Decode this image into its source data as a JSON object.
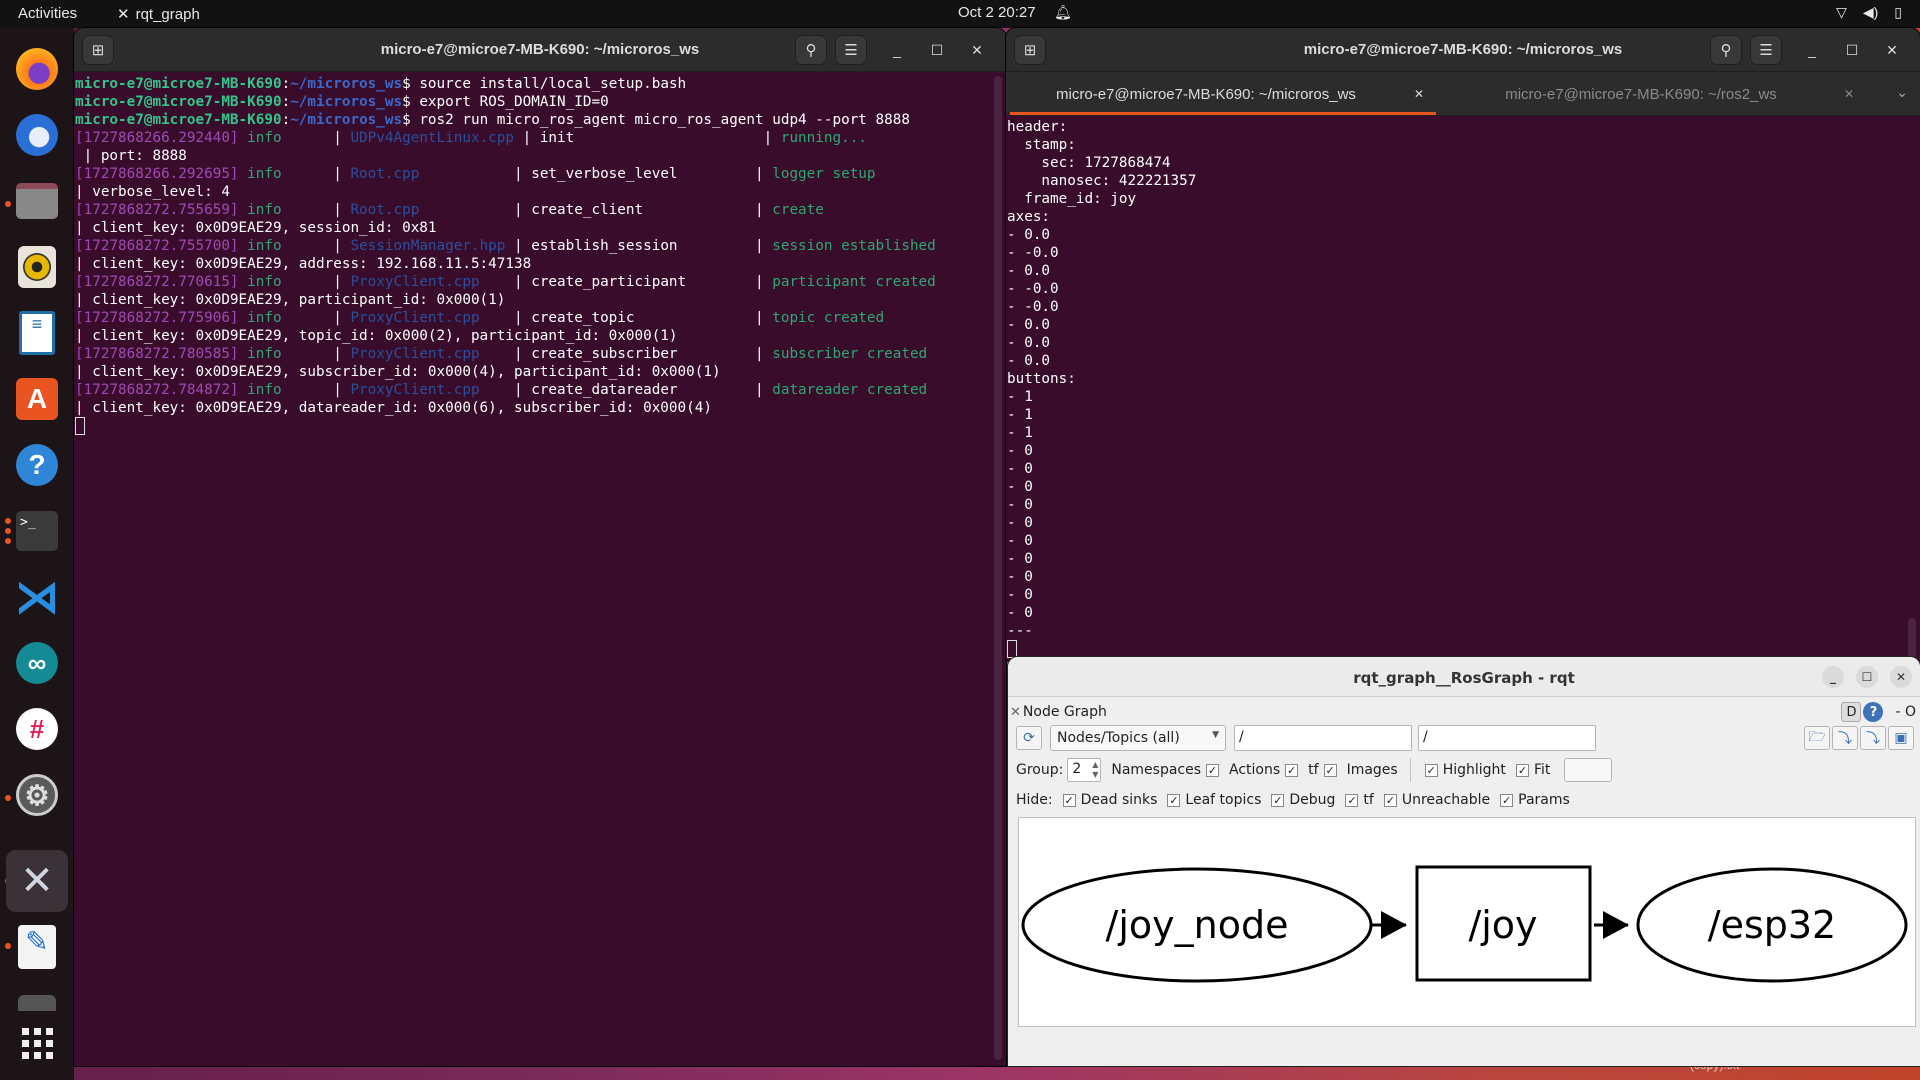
{
  "topbar": {
    "activities": "Activities",
    "app_name": "rqt_graph",
    "clock": "Oct 2  20:27",
    "tray_icons": [
      "network-icon",
      "volume-icon",
      "battery-icon"
    ]
  },
  "dock": {
    "items": [
      {
        "name": "firefox",
        "glyph": "🦊",
        "running": false
      },
      {
        "name": "thunderbird",
        "glyph": "✉",
        "running": false
      },
      {
        "name": "files",
        "glyph": "▬",
        "running": true
      },
      {
        "name": "rhythmbox",
        "glyph": "◉",
        "running": false
      },
      {
        "name": "libreoffice-writer",
        "glyph": "≡",
        "running": false
      },
      {
        "name": "app-center",
        "glyph": "A",
        "running": false
      },
      {
        "name": "help",
        "glyph": "?",
        "running": false
      },
      {
        "name": "terminal",
        "glyph": ">_",
        "running": true
      },
      {
        "name": "vscode",
        "glyph": "⋊",
        "running": false
      },
      {
        "name": "arduino",
        "glyph": "∞",
        "running": false
      },
      {
        "name": "slack",
        "glyph": "#",
        "running": false
      },
      {
        "name": "settings",
        "glyph": "⚙",
        "running": true
      },
      {
        "name": "rqt",
        "glyph": "✕",
        "running": true,
        "active": true
      },
      {
        "name": "text-editor",
        "glyph": "✎",
        "running": true
      },
      {
        "name": "trash",
        "glyph": "▭",
        "running": false
      },
      {
        "name": "show-apps",
        "glyph": "⠿",
        "running": false
      }
    ]
  },
  "left_terminal": {
    "title": "micro-e7@microe7-MB-K690: ~/microros_ws",
    "prompt_user": "micro-e7@microe7-MB-K690",
    "prompt_path": "~/microros_ws",
    "commands": [
      "source install/local_setup.bash",
      "export ROS_DOMAIN_ID=0",
      "ros2 run micro_ros_agent micro_ros_agent udp4 --port 8888"
    ],
    "log": [
      {
        "ts": "[1727868266.292440]",
        "level": "info",
        "file": "UDPv4AgentLinux.cpp",
        "func": "init",
        "msg": "running...",
        "detail": " | port: 8888"
      },
      {
        "ts": "[1727868266.292695]",
        "level": "info",
        "file": "Root.cpp",
        "func": "set_verbose_level",
        "msg": "logger setup",
        "detail": "| verbose_level: 4"
      },
      {
        "ts": "[1727868272.755659]",
        "level": "info",
        "file": "Root.cpp",
        "func": "create_client",
        "msg": "create",
        "detail": "| client_key: 0x0D9EAE29, session_id: 0x81"
      },
      {
        "ts": "[1727868272.755700]",
        "level": "info",
        "file": "SessionManager.hpp",
        "func": "establish_session",
        "msg": "session established",
        "detail": "| client_key: 0x0D9EAE29, address: 192.168.11.5:47138"
      },
      {
        "ts": "[1727868272.770615]",
        "level": "info",
        "file": "ProxyClient.cpp",
        "func": "create_participant",
        "msg": "participant created",
        "detail": "| client_key: 0x0D9EAE29, participant_id: 0x000(1)"
      },
      {
        "ts": "[1727868272.775906]",
        "level": "info",
        "file": "ProxyClient.cpp",
        "func": "create_topic",
        "msg": "topic created",
        "detail": "| client_key: 0x0D9EAE29, topic_id: 0x000(2), participant_id: 0x000(1)"
      },
      {
        "ts": "[1727868272.780585]",
        "level": "info",
        "file": "ProxyClient.cpp",
        "func": "create_subscriber",
        "msg": "subscriber created",
        "detail": "| client_key: 0x0D9EAE29, subscriber_id: 0x000(4), participant_id: 0x000(1)"
      },
      {
        "ts": "[1727868272.784872]",
        "level": "info",
        "file": "ProxyClient.cpp",
        "func": "create_datareader",
        "msg": "datareader created",
        "detail": "| client_key: 0x0D9EAE29, datareader_id: 0x000(6), subscriber_id: 0x000(4)"
      }
    ]
  },
  "right_terminal": {
    "title": "micro-e7@microe7-MB-K690: ~/microros_ws",
    "tabs": [
      {
        "label": "micro-e7@microe7-MB-K690: ~/microros_ws",
        "active": true
      },
      {
        "label": "micro-e7@microe7-MB-K690: ~/ros2_ws",
        "active": false
      }
    ],
    "output_lines": [
      "header:",
      "  stamp:",
      "    sec: 1727868474",
      "    nanosec: 422221357",
      "  frame_id: joy",
      "axes:",
      "- 0.0",
      "- -0.0",
      "- 0.0",
      "- -0.0",
      "- -0.0",
      "- 0.0",
      "- 0.0",
      "- 0.0",
      "buttons:",
      "- 1",
      "- 1",
      "- 1",
      "- 0",
      "- 0",
      "- 0",
      "- 0",
      "- 0",
      "- 0",
      "- 0",
      "- 0",
      "- 0",
      "- 0",
      "---"
    ]
  },
  "rqt": {
    "window_title": "rqt_graph__RosGraph - rqt",
    "plugin_title": "Node Graph",
    "plugin_right": {
      "d_label": "D",
      "help_label": "?",
      "extra": "- O"
    },
    "view_mode": "Nodes/Topics (all)",
    "node_filter": "/",
    "topic_filter": "/",
    "group_label": "Group:",
    "group_value": "2",
    "options": [
      {
        "label": "Namespaces",
        "checked": true,
        "box_after": true
      },
      {
        "label": "Actions",
        "checked": true
      },
      {
        "label": "tf",
        "checked": true
      },
      {
        "label": "Images",
        "checked": false
      }
    ],
    "highlight": {
      "label": "Highlight",
      "checked": true
    },
    "fit": {
      "label": "Fit",
      "checked": true
    },
    "hide_label": "Hide:",
    "hide_options": [
      {
        "label": "Dead sinks",
        "checked": true
      },
      {
        "label": "Leaf topics",
        "checked": true
      },
      {
        "label": "Debug",
        "checked": true
      },
      {
        "label": "tf",
        "checked": true
      },
      {
        "label": "Unreachable",
        "checked": true
      },
      {
        "label": "Params",
        "checked": true
      }
    ],
    "graph": {
      "nodes": [
        {
          "id": "joy_node",
          "label": "/joy_node",
          "shape": "ellipse"
        },
        {
          "id": "joy",
          "label": "/joy",
          "shape": "box"
        },
        {
          "id": "esp32",
          "label": "/esp32",
          "shape": "ellipse"
        }
      ],
      "edges": [
        {
          "from": "joy_node",
          "to": "joy"
        },
        {
          "from": "joy",
          "to": "esp32"
        }
      ]
    }
  },
  "desktop": {
    "partial_file_label": "(copy).txt"
  }
}
